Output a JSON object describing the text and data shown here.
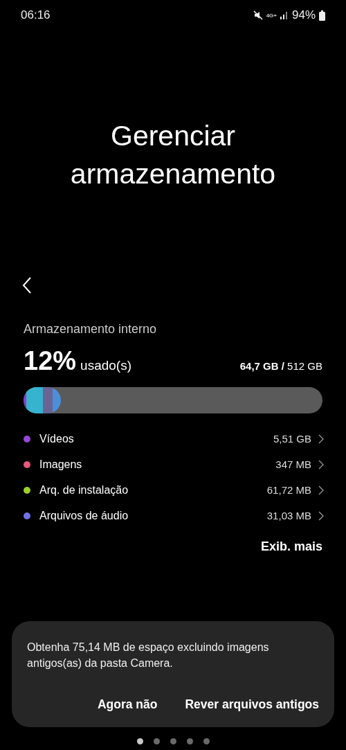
{
  "status_bar": {
    "time": "06:16",
    "network": "4G+",
    "battery": "94%"
  },
  "title": "Gerenciar armazenamento",
  "storage": {
    "heading": "Armazenamento interno",
    "percent": "12%",
    "used_label": "usado(s)",
    "used": "64,7 GB",
    "separator": "/",
    "total": "512 GB",
    "bar": {
      "segments": [
        {
          "color": "#8a3fc7"
        },
        {
          "color": "#35b3cf"
        },
        {
          "color": "#6a6494"
        },
        {
          "color": "#4b8fd8"
        }
      ]
    },
    "categories": [
      {
        "name": "Vídeos",
        "size": "5,51 GB",
        "color": "#9747d6"
      },
      {
        "name": "Imagens",
        "size": "347 MB",
        "color": "#e8587a"
      },
      {
        "name": "Arq. de instalação",
        "size": "61,72 MB",
        "color": "#9bcf2a"
      },
      {
        "name": "Arquivos de áudio",
        "size": "31,03 MB",
        "color": "#6f73e6"
      }
    ],
    "more_button": "Exib. mais"
  },
  "suggestion": {
    "message": "Obtenha 75,14 MB de espaço excluindo imagens antigos(as) da pasta Camera.",
    "buttons": [
      "Agora não",
      "Rever arquivos antigos"
    ]
  },
  "page_dots": [
    {
      "selected": true
    },
    {
      "selected": false
    },
    {
      "selected": false
    },
    {
      "selected": false
    },
    {
      "selected": false
    }
  ]
}
